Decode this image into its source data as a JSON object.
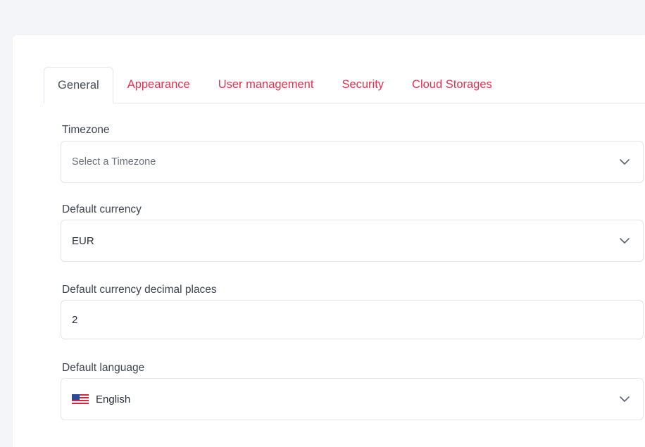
{
  "tabs": [
    {
      "label": "General",
      "active": true
    },
    {
      "label": "Appearance",
      "active": false
    },
    {
      "label": "User management",
      "active": false
    },
    {
      "label": "Security",
      "active": false
    },
    {
      "label": "Cloud Storages",
      "active": false
    }
  ],
  "fields": {
    "timezone": {
      "label": "Timezone",
      "placeholder": "Select a Timezone",
      "value": ""
    },
    "currency": {
      "label": "Default currency",
      "value": "EUR"
    },
    "decimal_places": {
      "label": "Default currency decimal places",
      "value": "2"
    },
    "language": {
      "label": "Default language",
      "value": "English",
      "flag_icon": "us-flag-icon"
    }
  },
  "colors": {
    "accent": "#e6304f",
    "active_tab_text": "#4a4f5c",
    "border": "#e3e5eb",
    "page_background": "#f4f5f8"
  }
}
